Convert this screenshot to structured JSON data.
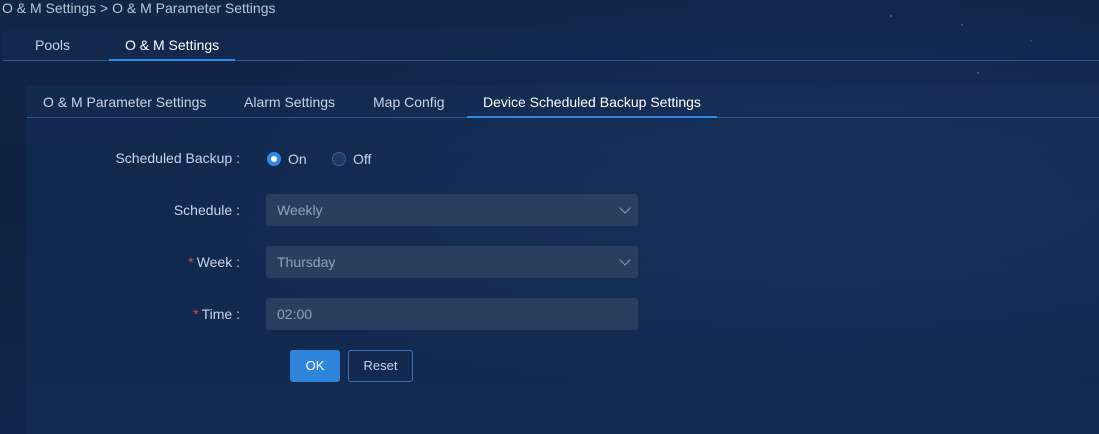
{
  "breadcrumb": "O & M Settings > O & M Parameter Settings",
  "top_tabs": [
    {
      "label": "Pools",
      "active": false
    },
    {
      "label": "O & M Settings",
      "active": true
    }
  ],
  "sub_tabs": [
    {
      "label": "O & M Parameter Settings",
      "active": false
    },
    {
      "label": "Alarm Settings",
      "active": false
    },
    {
      "label": "Map Config",
      "active": false
    },
    {
      "label": "Device Scheduled Backup Settings",
      "active": true
    }
  ],
  "form": {
    "scheduled_backup": {
      "label": "Scheduled Backup :",
      "options": [
        {
          "label": "On",
          "selected": true
        },
        {
          "label": "Off",
          "selected": false
        }
      ]
    },
    "schedule": {
      "label": "Schedule :",
      "value": "Weekly",
      "icon": "chevron-down-icon"
    },
    "week": {
      "required_mark": "*",
      "label": "Week :",
      "value": "Thursday",
      "icon": "chevron-down-icon"
    },
    "time": {
      "required_mark": "*",
      "label": "Time :",
      "value": "02:00"
    },
    "buttons": {
      "ok": "OK",
      "reset": "Reset"
    }
  },
  "colors": {
    "accent": "#2f8ae5",
    "background": "#0f1f3a",
    "required": "#e04b4b"
  }
}
